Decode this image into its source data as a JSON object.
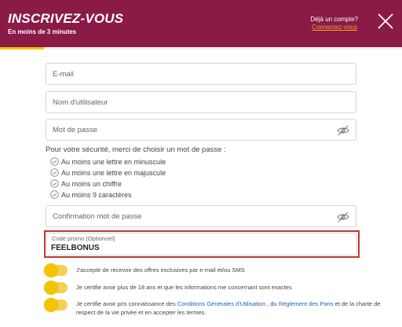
{
  "header": {
    "title": "INSCRIVEZ-VOUS",
    "subtitle": "En moins de 3 minutes",
    "account_question": "Déjà un compte?",
    "connect_link": "Connectez-vous",
    "close_icon": "close-icon",
    "progress_fraction": 0.11
  },
  "form": {
    "email_placeholder": "E-mail",
    "username_placeholder": "Nom d'utilisateur",
    "password_placeholder": "Mot de passe",
    "password_rules_intro": "Pour votre sécurité, merci de choisir un mot de passe :",
    "password_rules": [
      "Au moins une lettre en minuscule",
      "Au moins une lettre en majuscule",
      "Au moins un chiffre",
      "Au moins 9 caractères"
    ],
    "confirm_placeholder": "Confirmation mot de passe",
    "promo_label": "Code promo (Optionnel)",
    "promo_value": "FEELBONUS"
  },
  "consents": {
    "offers": "J'accepte de recevoir des offres exclusives par e-mail et/ou SMS",
    "age": "Je certifie avoir plus de 18 ans et que les informations me concernant sont exactes",
    "terms_prefix": "Je certifie avoir pris connaissance des ",
    "terms_link1": "Conditions Générales d'Utilisation",
    "terms_mid": " , du ",
    "terms_link2": "Règlement des Paris",
    "terms_suffix": " et de la charte de respect de la vie privée et en accepter les termes."
  },
  "colors": {
    "brand": "#8a1a46",
    "accent": "#f5c400",
    "link": "#f5a623",
    "highlight_border": "#c0392b"
  }
}
